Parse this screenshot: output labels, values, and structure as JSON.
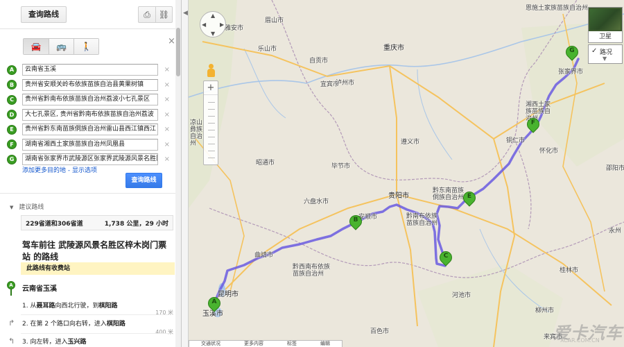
{
  "toolbar": {
    "get_directions_label": "查询路线",
    "print_icon": "print-icon",
    "link_icon": "link-icon"
  },
  "travel_modes": [
    {
      "name": "car-icon",
      "glyph": "🚘",
      "active": true
    },
    {
      "name": "bus-icon",
      "glyph": "🚌",
      "active": false
    },
    {
      "name": "walk-icon",
      "glyph": "🚶",
      "active": false
    }
  ],
  "waypoints": [
    {
      "letter": "A",
      "value": "云南省玉溪"
    },
    {
      "letter": "B",
      "value": "贵州省安顺关岭布依族苗族自治县黄果树镇"
    },
    {
      "letter": "C",
      "value": "贵州省黔南布依族苗族自治州荔波小七孔景区"
    },
    {
      "letter": "D",
      "value": "大七孔景区, 贵州省黔南布依族苗族自治州荔波"
    },
    {
      "letter": "E",
      "value": "贵州省黔东南苗族侗族自治州雷山县西江镇西江"
    },
    {
      "letter": "F",
      "value": "湖南省湘西土家族苗族自治州凤凰县"
    },
    {
      "letter": "G",
      "value": "湖南省张家界市武陵源区张家界武陵源风景名胜区"
    }
  ],
  "add_destination": "添加更多目的地 - 显示选项",
  "search_button": "查询路线",
  "suggested_routes": "建议路线",
  "route_summary": {
    "name": "229省道和306省道",
    "distance_time": "1,738 公里，29 小时"
  },
  "heading": "驾车前往 武陵源风景名胜区梓木岗门票站 的路线",
  "toll_notice": "此路线有收费站",
  "start_point": {
    "letter": "A",
    "label": "云南省玉溪"
  },
  "steps": [
    {
      "num": "1.",
      "pre": "从",
      "road1": "聂耳路",
      "mid": "向西北行驶，到",
      "road2": "棋阳路",
      "dist": "170 米"
    },
    {
      "num": "2.",
      "pre": "在第 2 个路口向右转，进入",
      "road1": "棋阳路",
      "mid": "",
      "road2": "",
      "dist": "400 米"
    },
    {
      "num": "3.",
      "pre": "向左转，进入",
      "road1": "玉兴路",
      "mid": "",
      "road2": "",
      "dist": ""
    }
  ],
  "map": {
    "satellite_label": "卫星",
    "traffic_label": "路况",
    "bottom_tabs": [
      "交通状况",
      "更多内容",
      "标签",
      "编辑"
    ],
    "route_color": "#6a5be0",
    "marker_color": "#49b32f",
    "markers": [
      {
        "letter": "A"
      },
      {
        "letter": "B"
      },
      {
        "letter": "C"
      },
      {
        "letter": "E"
      },
      {
        "letter": "F"
      },
      {
        "letter": "G"
      }
    ],
    "labels": [
      "眉山市",
      "雅安市",
      "乐山市",
      "宜宾市",
      "泸州市",
      "自贡市",
      "重庆市",
      "遵义市",
      "毕节市",
      "昭通市",
      "贵阳市",
      "安顺市",
      "六盘水市",
      "曲靖市",
      "昆明市",
      "玉溪市",
      "铜仁市",
      "怀化市",
      "张家界市",
      "湘西土家族苗族自治州",
      "黔东南苗族侗族自治州",
      "黔南布依族苗族自治州",
      "黔西南布依族苗族自治州",
      "河池市",
      "百色市",
      "柳州市",
      "桂林市",
      "邵阳市",
      "永州",
      "来宾市",
      "恩施土家族苗族自治州",
      "凉山彝族自治州",
      "宜宾市"
    ]
  },
  "watermark": {
    "main": "爱卡汽车",
    "sub": "XCAR.COM.CN"
  }
}
